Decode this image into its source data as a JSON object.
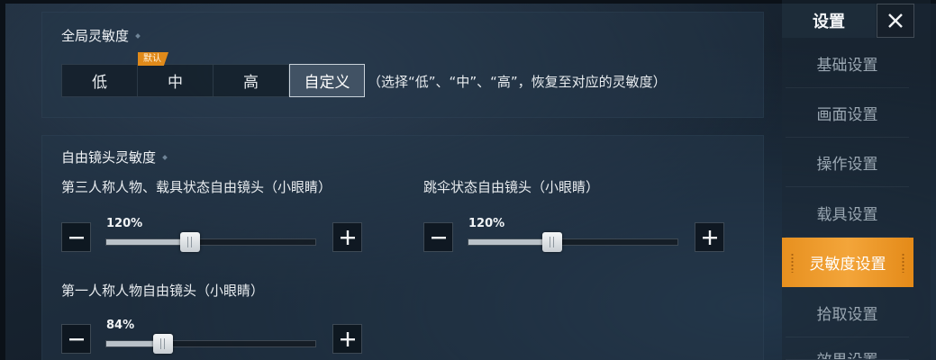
{
  "global_section": {
    "title": "全局灵敏度",
    "options": [
      "低",
      "中",
      "高",
      "自定义"
    ],
    "selected": "自定义",
    "default_badge": "默认",
    "hint": "（选择“低”、“中”、“高”，恢复至对应的灵敏度）"
  },
  "free_cam_section": {
    "title": "自由镜头灵敏度",
    "third_person": {
      "label": "第三人称人物、载具状态自由镜头（小眼睛）",
      "value_text": "120%",
      "fraction": 0.4
    },
    "parachute": {
      "label": "跳伞状态自由镜头（小眼睛）",
      "value_text": "120%",
      "fraction": 0.4
    },
    "first_person": {
      "label": "第一人称人物自由镜头（小眼睛）",
      "value_text": "84%",
      "fraction": 0.27
    }
  },
  "sidebar": {
    "title": "设置",
    "items": [
      {
        "label": "基础设置",
        "active": false
      },
      {
        "label": "画面设置",
        "active": false
      },
      {
        "label": "操作设置",
        "active": false
      },
      {
        "label": "载具设置",
        "active": false
      },
      {
        "label": "灵敏度设置",
        "active": true
      },
      {
        "label": "拾取设置",
        "active": false
      },
      {
        "label": "效果设置",
        "active": false
      }
    ]
  },
  "icons": {
    "minus": "minus-icon",
    "plus": "plus-icon",
    "close": "close-icon"
  },
  "colors": {
    "accent": "#f0a030",
    "badge": "#e08a1a"
  }
}
